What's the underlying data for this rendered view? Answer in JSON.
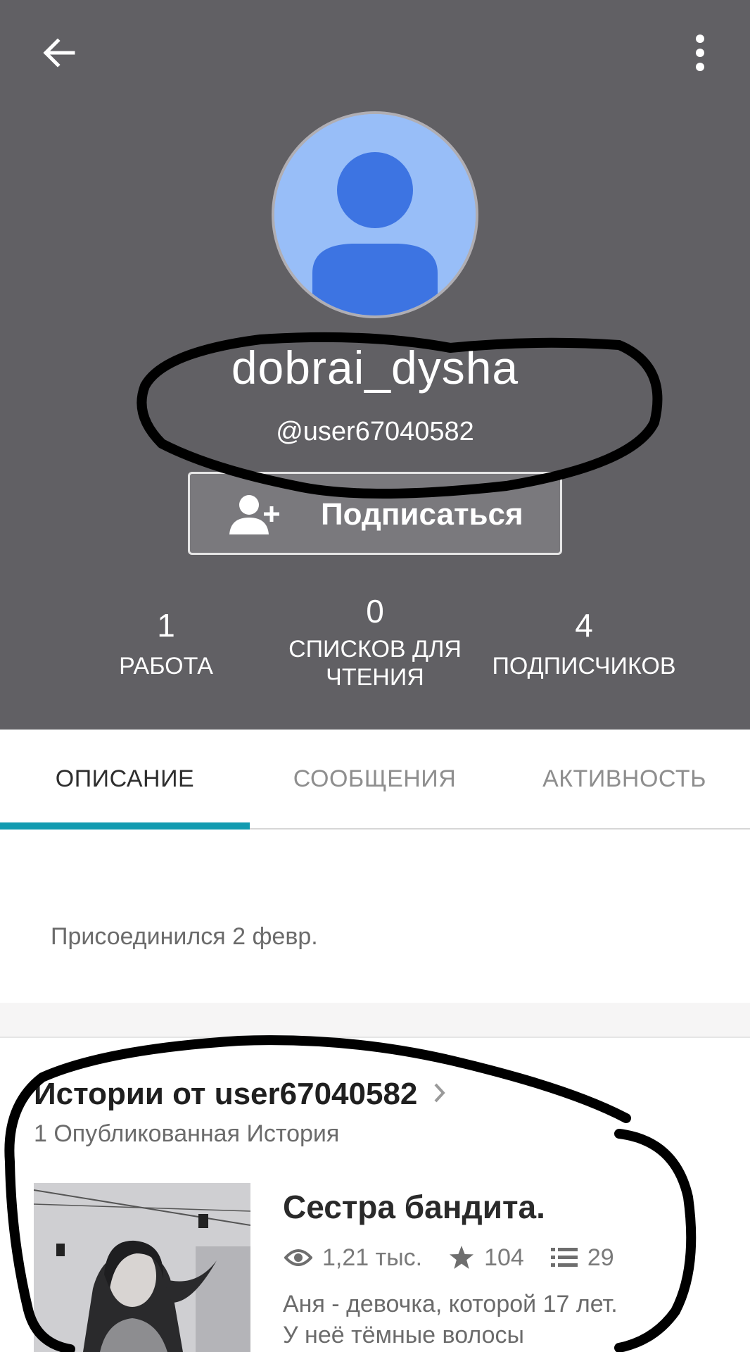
{
  "header": {
    "back_icon": "arrow-left-icon",
    "menu_icon": "more-vertical-icon",
    "background_color": "#616064",
    "display_name": "dobrai_dysha",
    "handle": "@user67040582",
    "follow_label": "Подписаться",
    "follow_icon": "add-user-icon"
  },
  "stats": [
    {
      "value": "1",
      "label": "РАБОТА"
    },
    {
      "value": "0",
      "label_line1": "СПИСКОВ ДЛЯ",
      "label_line2": "ЧТЕНИЯ"
    },
    {
      "value": "4",
      "label": "ПОДПИСЧИКОВ"
    }
  ],
  "tabs": [
    {
      "label": "ОПИСАНИЕ",
      "active": true
    },
    {
      "label": "СООБЩЕНИЯ",
      "active": false
    },
    {
      "label": "АКТИВНОСТЬ",
      "active": false
    }
  ],
  "tab_indicator_color": "#129bb0",
  "about": {
    "joined": "Присоединился 2 февр."
  },
  "stories": {
    "title": "Истории от user67040582",
    "subtitle": "1 Опубликованная История",
    "items": [
      {
        "title": "Сестра бандита.",
        "reads": "1,21 тыс.",
        "votes": "104",
        "parts": "29",
        "description": "Аня - девочка, которой 17 лет. У неё тёмные волосы"
      }
    ]
  }
}
